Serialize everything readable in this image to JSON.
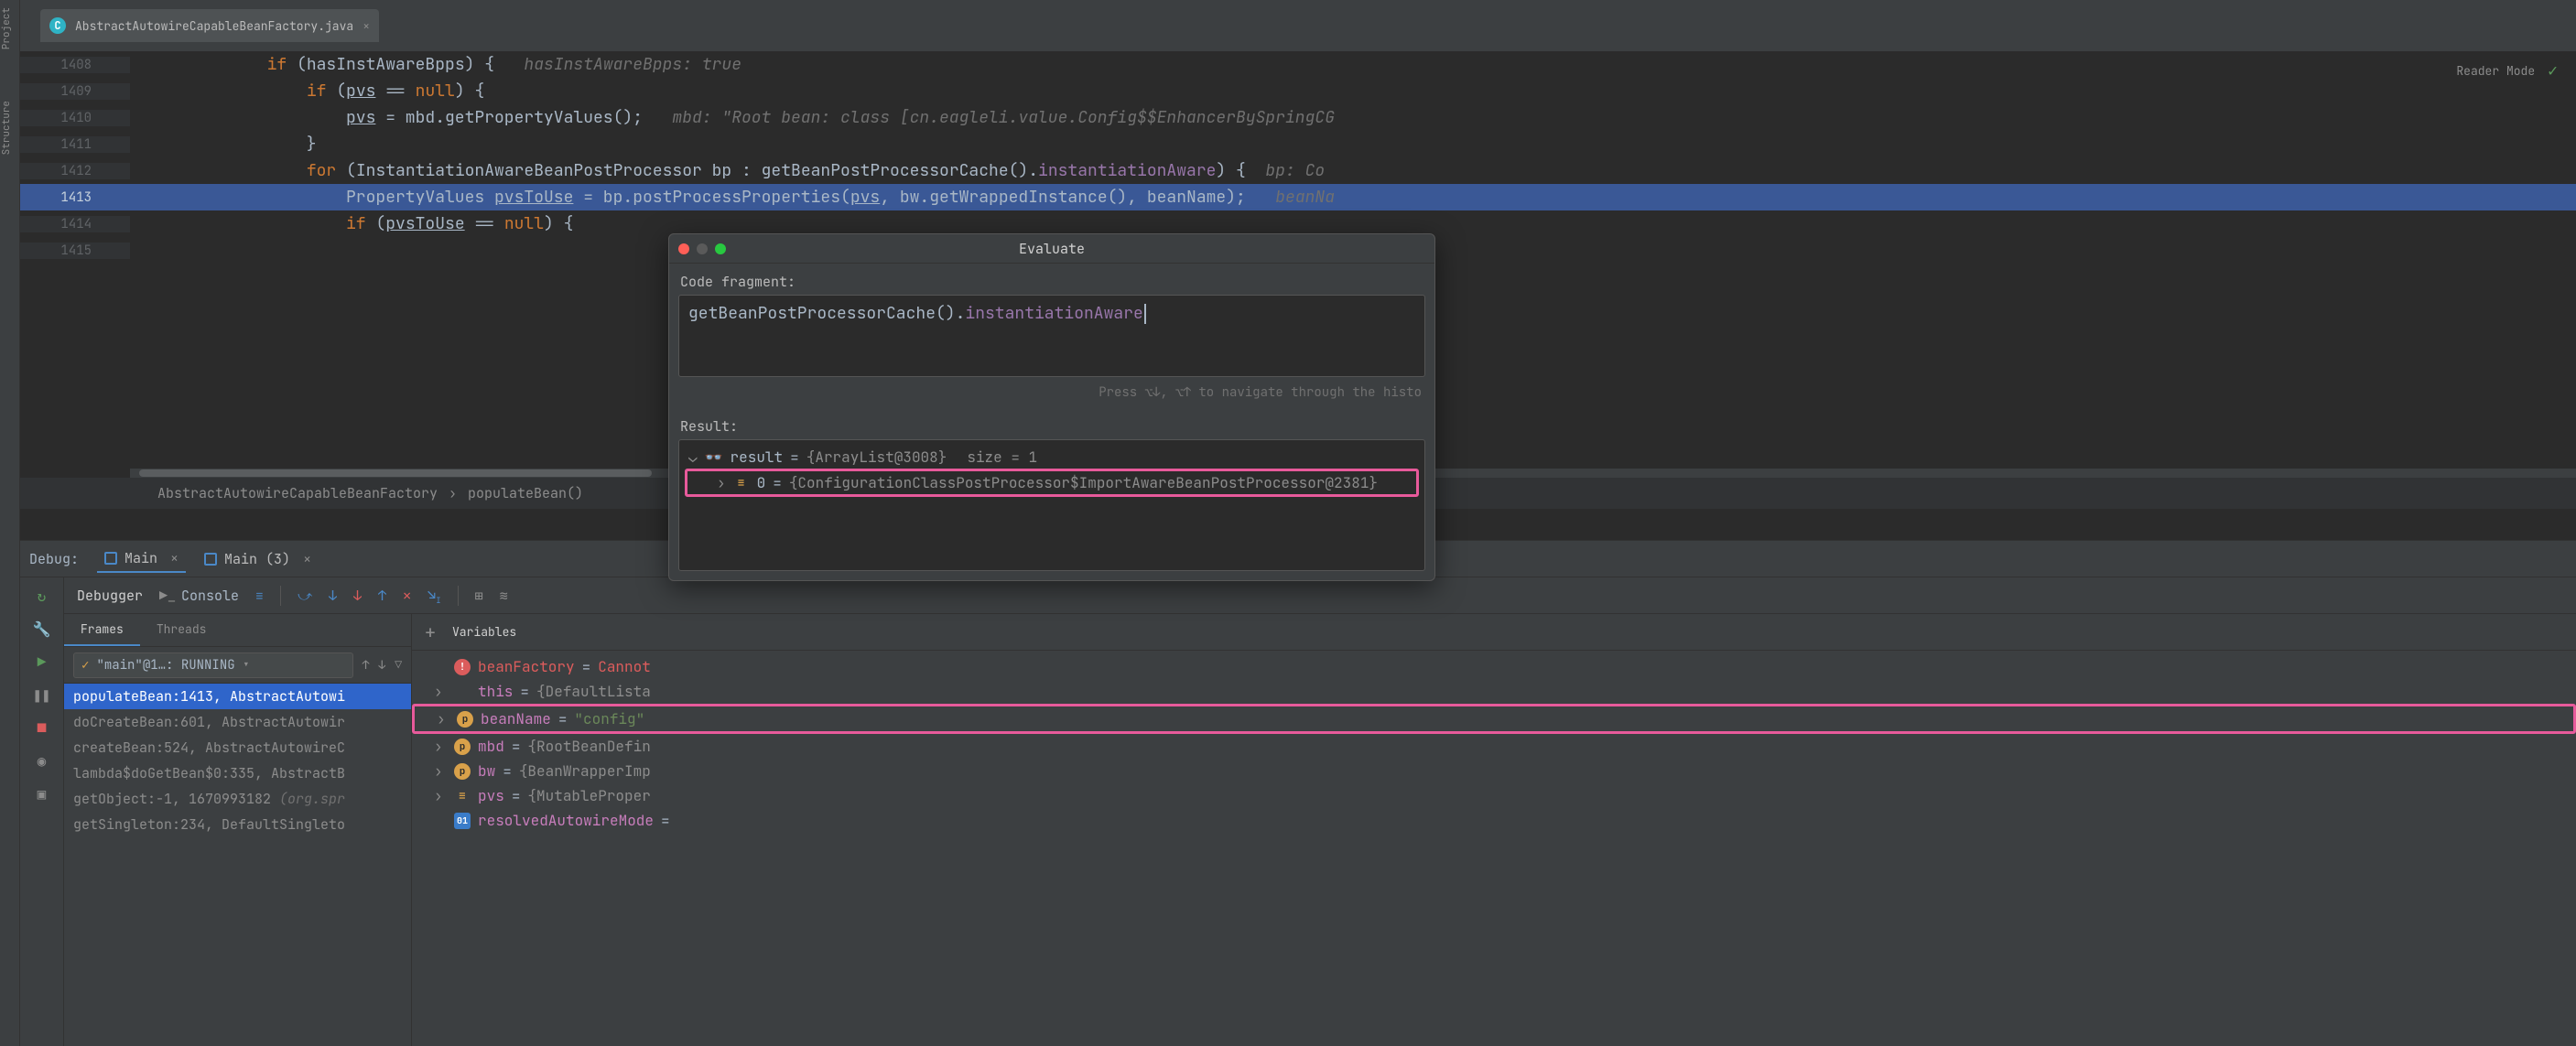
{
  "tab": {
    "filename": "AbstractAutowireCapableBeanFactory.java",
    "iconLetter": "C"
  },
  "readerMode": "Reader Mode",
  "code": {
    "lines": [
      {
        "n": "1408",
        "html": "<span class='kw'>if</span> (hasInstAwareBpps) {   <span class='inlinehint'>hasInstAwareBpps: true</span>",
        "indent": 12
      },
      {
        "n": "1409",
        "html": "<span class='kw'>if</span> (<span class='under'>pvs</span> == <span class='kw'>null</span>) {",
        "indent": 16
      },
      {
        "n": "1410",
        "html": "<span class='under'>pvs</span> = mbd.getPropertyValues();   <span class='inlinehint'>mbd: \"Root bean: class [cn.eagleli.value.Config$$EnhancerBySpringCG</span>",
        "indent": 20
      },
      {
        "n": "1411",
        "html": "}",
        "indent": 16
      },
      {
        "n": "1412",
        "html": "<span class='kw'>for</span> (InstantiationAwareBeanPostProcessor bp : getBeanPostProcessorCache().<span class='field'>instantiationAware</span>) {  <span class='inlinehint'>bp: Co</span>",
        "indent": 16
      },
      {
        "n": "1413",
        "bp": true,
        "html": "PropertyValues <span class='under'>pvsToUse</span> = bp.postProcessProperties(<span class='under'>pvs</span>, bw.getWrappedInstance(), beanName);   <span class='inlinehint'>beanNa</span>",
        "indent": 20
      },
      {
        "n": "1414",
        "html": "<span class='kw'>if</span> (<span class='under'>pvsToUse</span> == <span class='kw'>null</span>) {",
        "indent": 20
      },
      {
        "n": "1415",
        "html": "",
        "indent": 24
      }
    ]
  },
  "breadcrumb": {
    "parts": [
      "AbstractAutowireCapableBeanFactory",
      "populateBean()"
    ]
  },
  "debug": {
    "label": "Debug:",
    "tabs": [
      {
        "label": "Main",
        "active": true,
        "closable": true
      },
      {
        "label": "Main (3)",
        "active": false,
        "closable": true
      }
    ],
    "toolbar": {
      "debugger": "Debugger",
      "console": "Console"
    },
    "panes": {
      "frames": "Frames",
      "threads": "Threads",
      "variables": "Variables"
    },
    "thread": "\"main\"@1…: RUNNING",
    "frames": [
      {
        "text": "populateBean:1413, AbstractAutowi",
        "active": true
      },
      {
        "text": "doCreateBean:601, AbstractAutowir"
      },
      {
        "text": "createBean:524, AbstractAutowireC"
      },
      {
        "text": "lambda$doGetBean$0:335, AbstractB"
      },
      {
        "text": "getObject:-1, 1670993182 ",
        "muted": "(org.spr"
      },
      {
        "text": "getSingleton:234, DefaultSingleto"
      }
    ],
    "vars": [
      {
        "icon": "err",
        "name": "beanFactory",
        "val": "Cannot",
        "err": true
      },
      {
        "chev": true,
        "name": "this",
        "val": "{DefaultLista"
      },
      {
        "chev": true,
        "icon": "p",
        "name": "beanName",
        "val": "\"config\"",
        "str": true,
        "hl": true
      },
      {
        "chev": true,
        "icon": "p",
        "name": "mbd",
        "val": "{RootBeanDefin"
      },
      {
        "chev": true,
        "icon": "p",
        "name": "bw",
        "val": "{BeanWrapperImp"
      },
      {
        "chev": true,
        "icon": "bars",
        "name": "pvs",
        "val": "{MutableProper"
      },
      {
        "icon": "zo",
        "name": "resolvedAutowireMode",
        "val": ""
      }
    ]
  },
  "evaluate": {
    "title": "Evaluate",
    "codeFragmentLabel": "Code fragment:",
    "expression": "getBeanPostProcessorCache().instantiationAware",
    "exprPlain": "getBeanPostProcessorCache().",
    "exprField": "instantiationAware",
    "hint": "Press ⌥↓, ⌥↑ to navigate through the histo",
    "resultLabel": "Result:",
    "results": [
      {
        "open": true,
        "glasses": true,
        "name": "result",
        "val": "{ArrayList@3008}",
        "extra": "size = 1"
      },
      {
        "indent": true,
        "chev": true,
        "bars": true,
        "name": "0",
        "val": "{ConfigurationClassPostProcessor$ImportAwareBeanPostProcessor@2381}",
        "hl": true
      }
    ]
  }
}
